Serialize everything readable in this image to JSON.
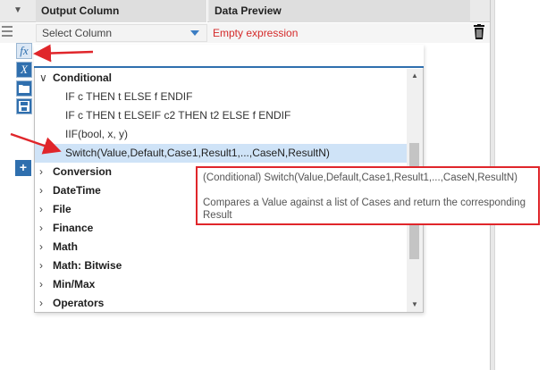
{
  "grid": {
    "headers": {
      "output": "Output Column",
      "preview": "Data Preview"
    },
    "row": {
      "select_label": "Select Column",
      "preview_value": "Empty expression"
    }
  },
  "tools": {
    "fx": "fx",
    "x": "X",
    "add": "+"
  },
  "search": {
    "value": ""
  },
  "list": [
    {
      "kind": "category",
      "label": "Conditional",
      "expanded": true
    },
    {
      "kind": "function",
      "label": "IF c THEN t ELSE f ENDIF"
    },
    {
      "kind": "function",
      "label": "IF c THEN t ELSEIF c2 THEN t2 ELSE f ENDIF"
    },
    {
      "kind": "function",
      "label": "IIF(bool, x, y)"
    },
    {
      "kind": "function",
      "label": "Switch(Value,Default,Case1,Result1,...,CaseN,ResultN)",
      "selected": true
    },
    {
      "kind": "category",
      "label": "Conversion"
    },
    {
      "kind": "category",
      "label": "DateTime"
    },
    {
      "kind": "category",
      "label": "File"
    },
    {
      "kind": "category",
      "label": "Finance"
    },
    {
      "kind": "category",
      "label": "Math"
    },
    {
      "kind": "category",
      "label": "Math: Bitwise"
    },
    {
      "kind": "category",
      "label": "Min/Max"
    },
    {
      "kind": "category",
      "label": "Operators"
    }
  ],
  "tooltip": {
    "signature": "(Conditional) Switch(Value,Default,Case1,Result1,...,CaseN,ResultN)",
    "description": "Compares a Value against a list of Cases and return the corresponding Result"
  },
  "colors": {
    "accent": "#2f6fae",
    "error_text": "#d42a2a",
    "highlight": "#cfe3f7",
    "annotation": "#e0262b"
  },
  "icons": [
    "fx-icon",
    "variable-x-icon",
    "open-folder-icon",
    "save-icon",
    "add-icon",
    "delete-trash-icon",
    "search-icon",
    "chevron-down-icon",
    "chevron-right-icon"
  ]
}
